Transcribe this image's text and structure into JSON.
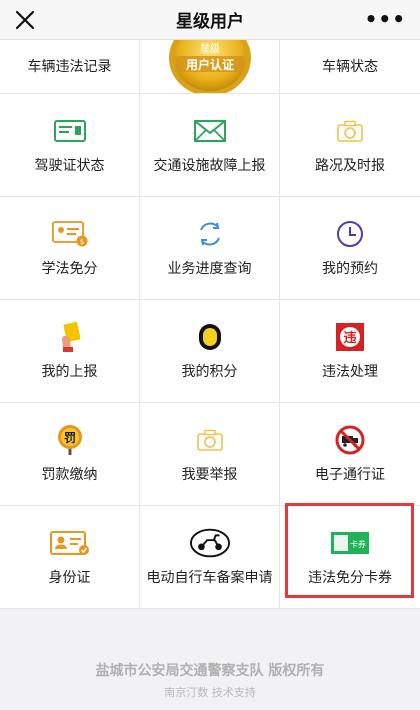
{
  "nav": {
    "title": "星级用户",
    "close_icon": "close-icon",
    "more_icon": "more-icon"
  },
  "badge": {
    "line1": "星级",
    "line2": "用户认证"
  },
  "grid": {
    "row0": [
      "车辆违法记录",
      "",
      "车辆状态"
    ],
    "row1": [
      "驾驶证状态",
      "交通设施故障上报",
      "路况及时报"
    ],
    "row2": [
      "学法免分",
      "业务进度查询",
      "我的预约"
    ],
    "row3": [
      "我的上报",
      "我的积分",
      "违法处理"
    ],
    "row4": [
      "罚款缴纳",
      "我要举报",
      "电子通行证"
    ],
    "row5": [
      "身份证",
      "电动自行车备案申请",
      "违法免分卡券"
    ]
  },
  "icons": {
    "license": "driver-license-icon",
    "mail": "envelope-icon",
    "camera": "camera-icon",
    "study": "study-card-icon",
    "progress": "progress-icon",
    "clock": "clock-icon",
    "yellowcard": "yellow-card-icon",
    "points": "coin-icon",
    "violation": "violation-icon",
    "fine": "fine-sign-icon",
    "report": "camera-icon",
    "pass": "no-truck-icon",
    "idcard": "id-card-icon",
    "ebike": "ebike-icon",
    "coupon": "coupon-icon"
  },
  "coupon_text": "卡券",
  "fine_text": "罚",
  "violation_text": "违",
  "footer": {
    "copyright": "盐城市公安局交通警察支队 版权所有",
    "support": "南京汀数 技术支持"
  },
  "colors": {
    "accent_green": "#2aa55a",
    "orange": "#e8961e",
    "highlight_red": "#e03c3c",
    "gold": "#e9b21a"
  }
}
